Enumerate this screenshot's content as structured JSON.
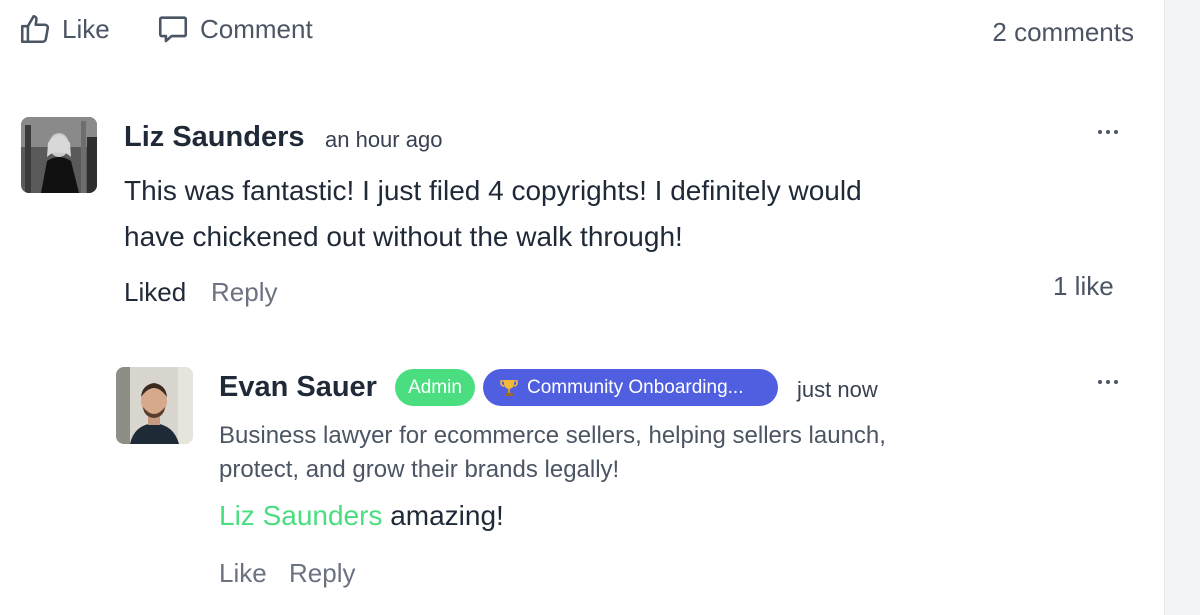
{
  "actions": {
    "like_label": "Like",
    "comment_label": "Comment",
    "comments_count": "2 comments"
  },
  "comments": [
    {
      "author": "Liz Saunders",
      "time": "an hour ago",
      "text_line1": "This was fantastic! I just filed 4 copyrights!  I definitely would",
      "text_line2": "have chickened out without the walk through!",
      "liked_label": "Liked",
      "reply_label": "Reply",
      "likes": "1 like"
    },
    {
      "author": "Evan Sauer",
      "badge_admin": "Admin",
      "badge_community": "Community Onboarding...",
      "badge_community_icon": "trophy-icon",
      "time": "just now",
      "headline_line1": "Business lawyer for ecommerce sellers, helping sellers launch,",
      "headline_line2": "protect, and grow their brands legally!",
      "mention": "Liz Saunders",
      "text": " amazing!",
      "like_label": "Like",
      "reply_label": "Reply"
    }
  ],
  "colors": {
    "admin_badge": "#4ade80",
    "community_badge": "#4f5fe0",
    "mention": "#4ade80",
    "text": "#1f2937",
    "muted": "#6b7280"
  }
}
